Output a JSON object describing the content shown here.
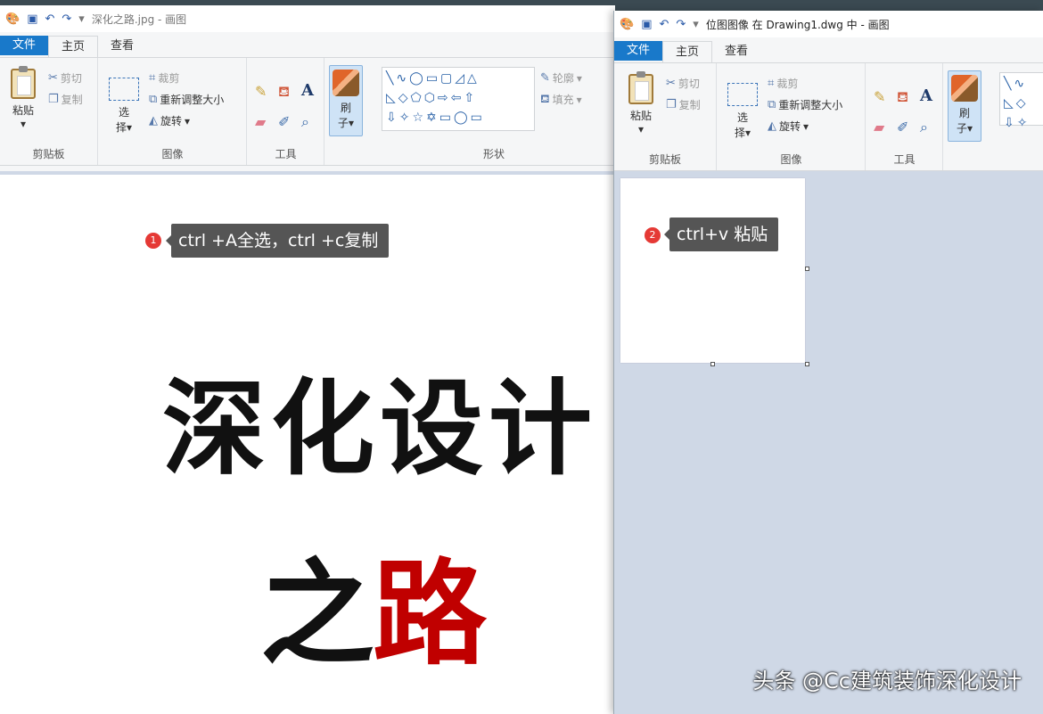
{
  "window1": {
    "title": "深化之路.jpg - 画图",
    "tabs": [
      "文件",
      "主页",
      "查看"
    ],
    "clipboard": {
      "paste": "粘贴",
      "cut": "剪切",
      "copy": "复制",
      "group": "剪贴板"
    },
    "image": {
      "select_top": "选",
      "select_bottom": "择",
      "crop": "裁剪",
      "resize": "重新调整大小",
      "rotate": "旋转",
      "group": "图像"
    },
    "tools": {
      "group": "工具",
      "text": "A"
    },
    "brush": {
      "top": "刷",
      "bottom": "子"
    },
    "shapes": {
      "group": "形状",
      "outline": "轮廓",
      "fill": "填充"
    },
    "canvas": {
      "line1": "深化设计",
      "line2_a": "之",
      "line2_b": "路"
    },
    "annotation": {
      "number": "1",
      "text": "ctrl +A全选，ctrl +c复制"
    }
  },
  "window2": {
    "title": "位图图像 在 Drawing1.dwg 中 - 画图",
    "tabs": [
      "文件",
      "主页",
      "查看"
    ],
    "clipboard": {
      "paste": "粘贴",
      "cut": "剪切",
      "copy": "复制",
      "group": "剪贴板"
    },
    "image": {
      "select_top": "选",
      "select_bottom": "择",
      "crop": "裁剪",
      "resize": "重新调整大小",
      "rotate": "旋转",
      "group": "图像"
    },
    "tools": {
      "group": "工具",
      "text": "A"
    },
    "brush": {
      "top": "刷",
      "bottom": "子"
    },
    "annotation": {
      "number": "2",
      "text": "ctrl+v 粘贴"
    }
  },
  "watermark": "头条 @Cc建筑装饰深化设计",
  "colors": {
    "file_tab": "#1979ca",
    "accent_red": "#c00000",
    "annotation_bg": "#555555",
    "badge": "#e53935"
  }
}
